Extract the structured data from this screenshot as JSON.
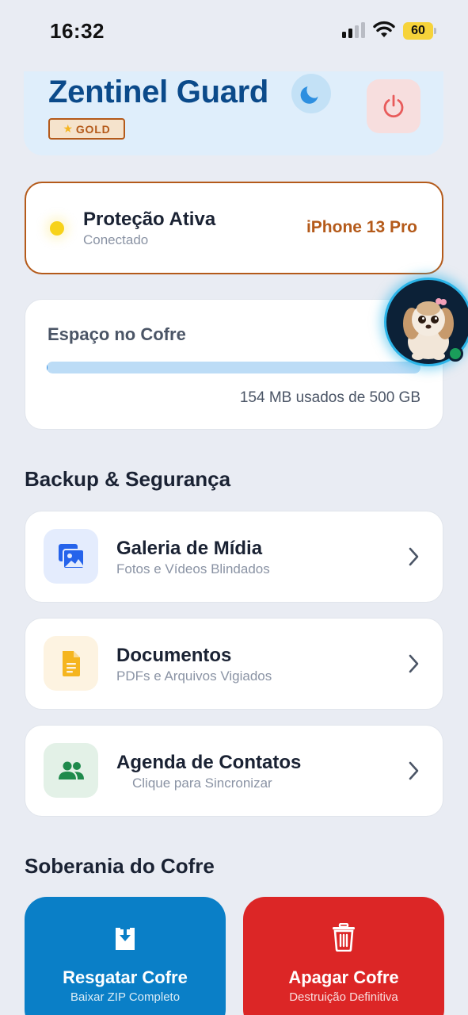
{
  "status_bar": {
    "time": "16:32",
    "battery": "60"
  },
  "header": {
    "title": "Zentinel Guard",
    "badge": "GOLD",
    "badge_icon": "star-icon"
  },
  "protection": {
    "title": "Proteção Ativa",
    "status": "Conectado",
    "device": "iPhone 13 Pro"
  },
  "storage": {
    "title": "Espaço no Cofre",
    "usage": "154 MB usados de 500 GB",
    "used_fraction": 0.0003
  },
  "backup": {
    "section_title": "Backup & Segurança",
    "items": [
      {
        "title": "Galeria de Mídia",
        "subtitle": "Fotos e Vídeos Blindados",
        "icon": "image-icon",
        "color": "#2563eb"
      },
      {
        "title": "Documentos",
        "subtitle": "PDFs e Arquivos Vigiados",
        "icon": "document-icon",
        "color": "#f5b51f"
      },
      {
        "title": "Agenda de Contatos",
        "subtitle": "Clique para Sincronizar",
        "icon": "contacts-icon",
        "color": "#1f8a4c"
      }
    ]
  },
  "sovereignty": {
    "section_title": "Soberania do Cofre",
    "rescue": {
      "title": "Resgatar Cofre",
      "subtitle": "Baixar ZIP Completo",
      "color": "#0a7fc7"
    },
    "delete": {
      "title": "Apagar Cofre",
      "subtitle": "Destruição Definitiva",
      "color": "#dc2626"
    }
  },
  "colors": {
    "brand": "#0b4a8a",
    "accent": "#b45a1a",
    "background": "#e9ecf3"
  }
}
